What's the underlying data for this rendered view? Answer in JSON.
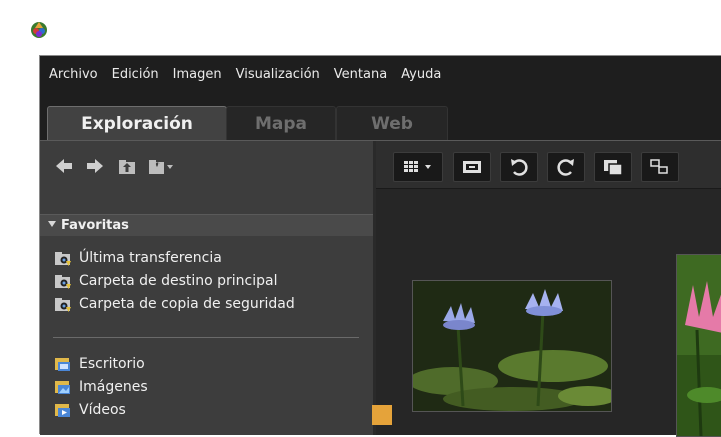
{
  "menu": {
    "items": [
      {
        "label": "Archivo"
      },
      {
        "label": "Edición"
      },
      {
        "label": "Imagen"
      },
      {
        "label": "Visualización"
      },
      {
        "label": "Ventana"
      },
      {
        "label": "Ayuda"
      }
    ]
  },
  "tabs": [
    {
      "label": "Exploración",
      "active": true
    },
    {
      "label": "Mapa",
      "active": false
    },
    {
      "label": "Web",
      "active": false
    }
  ],
  "nav_icons": [
    "arrow-left-icon",
    "arrow-right-icon",
    "folder-up-icon",
    "favorite-folder-icon"
  ],
  "favorites": {
    "title": "Favoritas",
    "items": [
      {
        "label": "Última transferencia"
      },
      {
        "label": "Carpeta de destino principal"
      },
      {
        "label": "Carpeta de copia de seguridad"
      }
    ]
  },
  "locations": {
    "items": [
      {
        "label": "Escritorio"
      },
      {
        "label": "Imágenes"
      },
      {
        "label": "Vídeos"
      }
    ]
  },
  "toolbar_icons": [
    "grid-view-icon",
    "fit-view-icon",
    "rotate-left-icon",
    "rotate-right-icon",
    "compare-icon",
    "more-icon"
  ],
  "thumbnails": [
    {
      "label": "water lilies photo",
      "badge_color": "#e5a33a"
    },
    {
      "label": "pink lotus photo"
    }
  ],
  "colors": {
    "frame_bg": "#1e1e1e",
    "panel_bg": "#3d3d3d",
    "accent_badge": "#e5a33a"
  }
}
